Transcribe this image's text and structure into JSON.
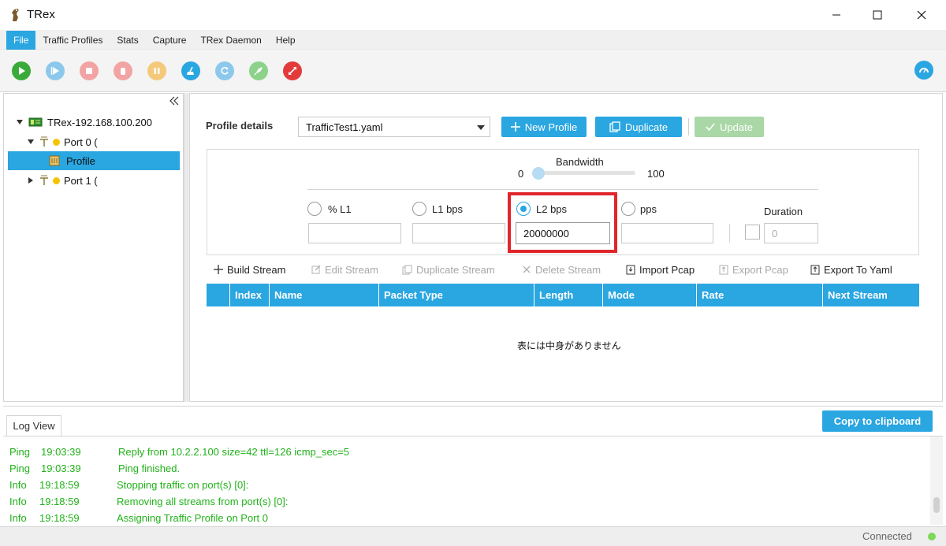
{
  "window": {
    "title": "TRex"
  },
  "menu": [
    "File",
    "Traffic Profiles",
    "Stats",
    "Capture",
    "TRex Daemon",
    "Help"
  ],
  "toolbar": {
    "icons": [
      "start-icon",
      "resume-icon",
      "stop-icon",
      "stop-all-icon",
      "pause-icon",
      "clear-stats-icon",
      "refresh-icon",
      "rocket-icon",
      "disconnect-icon",
      "dashboard-icon"
    ]
  },
  "tree": {
    "server": "TRex-192.168.100.200",
    "port0": "Port 0 (",
    "profile": "Profile",
    "port1": "Port 1 ("
  },
  "profile": {
    "details_label": "Profile details",
    "selected_file": "TrafficTest1.yaml",
    "new_profile": "New Profile",
    "duplicate": "Duplicate",
    "update": "Update"
  },
  "bandwidth": {
    "label": "Bandwidth",
    "min": "0",
    "max": "100",
    "value": 0
  },
  "rate_modes": {
    "l1_percent": "% L1",
    "l1_bps": "L1 bps",
    "l2_bps": "L2 bps",
    "pps": "pps",
    "selected": "L2 bps",
    "l2_bps_value": "20000000",
    "duration_label": "Duration",
    "duration_placeholder": "0"
  },
  "stream_toolbar": {
    "build": "Build Stream",
    "edit": "Edit Stream",
    "duplicate": "Duplicate Stream",
    "delete": "Delete Stream",
    "import_pcap": "Import Pcap",
    "export_pcap": "Export Pcap",
    "export_yaml": "Export To Yaml"
  },
  "table": {
    "columns": [
      "Index",
      "Name",
      "Packet Type",
      "Length",
      "Mode",
      "Rate",
      "Next Stream"
    ],
    "empty_message": "表には中身がありません"
  },
  "log": {
    "tab": "Log View",
    "copy_button": "Copy to clipboard",
    "entries": [
      {
        "level": "Ping",
        "time": "19:03:39",
        "message": "Reply from 10.2.2.100 size=42 ttl=126 icmp_sec=5"
      },
      {
        "level": "Ping",
        "time": "19:03:39",
        "message": "Ping finished."
      },
      {
        "level": "Info",
        "time": "19:18:59",
        "message": "Stopping traffic on port(s) [0]:"
      },
      {
        "level": "Info",
        "time": "19:18:59",
        "message": "Removing all streams from port(s) [0]:"
      },
      {
        "level": "Info",
        "time": "19:18:59",
        "message": "Assigning Traffic Profile on Port 0"
      }
    ]
  },
  "status": {
    "connection": "Connected"
  },
  "colors": {
    "accent": "#2aa6e1",
    "log_text": "#21b21a",
    "highlight": "#e0262b",
    "status_dot": "#7ed957"
  }
}
